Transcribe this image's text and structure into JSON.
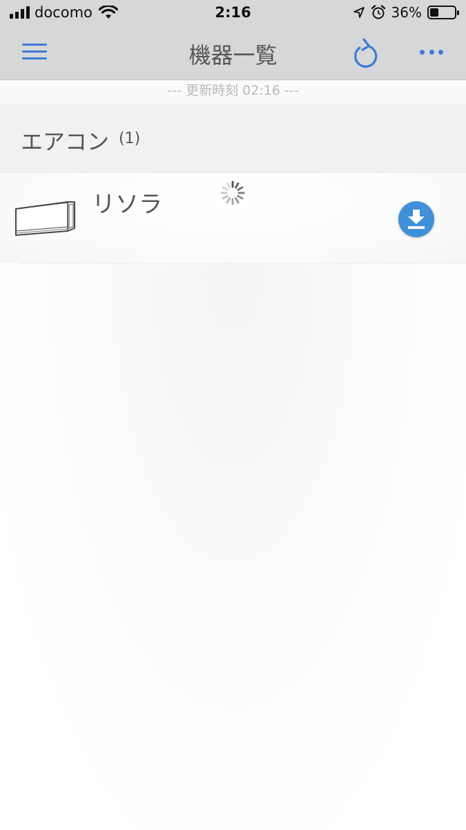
{
  "status_bar": {
    "carrier": "docomo",
    "time": "2:16",
    "battery_percent": "36%",
    "battery_level": 0.36,
    "icons": [
      "signal-icon",
      "wifi-icon",
      "location-icon",
      "alarm-icon",
      "battery-icon"
    ]
  },
  "nav": {
    "title": "機器一覧",
    "menu_icon": "hamburger-menu-icon",
    "refresh_icon": "refresh-icon",
    "more_icon": "more-dots-icon"
  },
  "update": {
    "text": "--- 更新時刻 02:16 ---"
  },
  "section": {
    "title": "エアコン",
    "count": "(1)"
  },
  "devices": [
    {
      "name": "リソラ",
      "icon": "air-conditioner-icon",
      "status_icon": "loading-spinner-icon",
      "action_icon": "download-icon"
    }
  ],
  "colors": {
    "accent": "#3b7bd6",
    "download_button": "#3f8fd9",
    "nav_background": "#d6d7d9",
    "section_background": "#f1f1f2"
  }
}
